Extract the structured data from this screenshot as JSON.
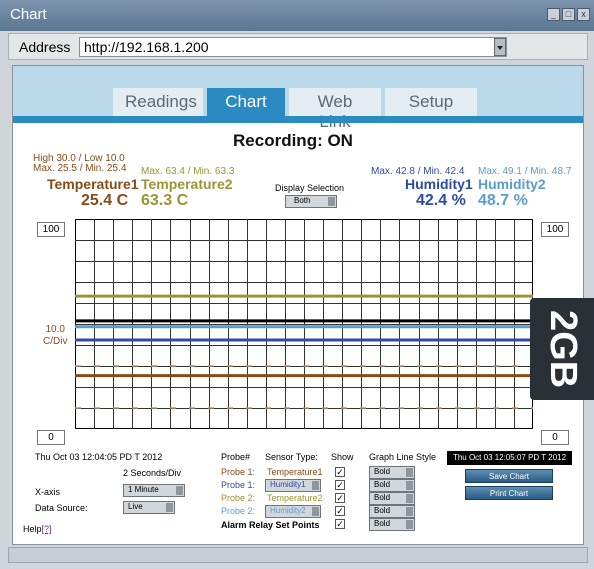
{
  "window": {
    "title": "Chart"
  },
  "address": {
    "label": "Address",
    "url": "http://192.168.1.200"
  },
  "tabs": [
    "Readings",
    "Chart",
    "Web Link",
    "Setup"
  ],
  "recording": "Recording: ON",
  "temp1": {
    "hilow": "High 30.0 / Low 10.0",
    "maxmin": "Max. 25.5 / Min. 25.4",
    "name": "Temperature1",
    "value": "25.4 C",
    "color": "#8a4b18"
  },
  "temp2": {
    "maxmin": "Max. 63.4 / Min. 63.3",
    "name": "Temperature2",
    "value": "63.3 C",
    "color": "#9a9433"
  },
  "hum1": {
    "maxmin": "Max. 42.8 / Min. 42.4",
    "name": "Humidity1",
    "value": "42.4 %",
    "color": "#2c4aa6"
  },
  "hum2": {
    "maxmin": "Max. 49.1 / Min. 48.7",
    "name": "Humidity2",
    "value": "48.7 %",
    "color": "#5b9bd0"
  },
  "display_selection": {
    "label": "Display Selection",
    "value": "Both"
  },
  "y_left_top": "100",
  "y_left_bottom": "0",
  "y_right_top": "100",
  "y_right_bottom": "0",
  "div_label": "10.0",
  "div_unit": "C/Div",
  "time_start": "Thu Oct 03 12:04:05 PD T 2012",
  "time_end": "Thu Oct 03 12:05:07 PD T 2012",
  "seconds_div": "2 Seconds/Div",
  "xaxis": {
    "label": "X-axis",
    "value": "1 Minute"
  },
  "datasource": {
    "label": "Data Source:",
    "value": "Live"
  },
  "probe_header": "Probe#",
  "sensor_header": "Sensor Type:",
  "show_header": "Show",
  "style_header": "Graph Line Style",
  "probes": [
    {
      "probe": "Probe 1:",
      "sensor": "Temperature1",
      "style": "Bold",
      "color": "#8a4b18"
    },
    {
      "probe": "Probe 1:",
      "sensor": "Humidity1",
      "style": "Bold",
      "color": "#2c4aa6"
    },
    {
      "probe": "Probe 2:",
      "sensor": "Temperature2",
      "style": "Bold",
      "color": "#9a9433"
    },
    {
      "probe": "Probe 2:",
      "sensor": "Humidity2",
      "style": "Bold",
      "color": "#5b9bd0"
    }
  ],
  "alarm_label": "Alarm Relay Set Points",
  "alarm_style": "Bold",
  "save_chart": "Save Chart",
  "print_chart": "Print Chart",
  "help": "Help",
  "help_link": "[?]",
  "gb_chip": "2GB",
  "chart_data": {
    "type": "line",
    "ylim": [
      0,
      100
    ],
    "series": [
      {
        "name": "Temperature1",
        "values": [
          25.4,
          25.4,
          25.4,
          25.4,
          25.4,
          25.4,
          25.4,
          25.4,
          25.4,
          25.4
        ],
        "color": "#8a4b18"
      },
      {
        "name": "Temperature2",
        "values": [
          63.3,
          63.3,
          63.3,
          63.3,
          63.3,
          63.3,
          63.3,
          63.3,
          63.3,
          63.3
        ],
        "color": "#9a9433"
      },
      {
        "name": "Humidity1",
        "values": [
          42.4,
          42.4,
          42.4,
          42.4,
          42.4,
          42.4,
          42.4,
          42.4,
          42.4,
          42.4
        ],
        "color": "#2c4aa6"
      },
      {
        "name": "Humidity2",
        "values": [
          48.7,
          48.7,
          48.7,
          48.7,
          48.7,
          48.7,
          48.7,
          48.7,
          48.7,
          48.7
        ],
        "color": "#5b9bd0"
      },
      {
        "name": "High",
        "values": [
          30,
          30,
          30,
          30,
          30,
          30,
          30,
          30,
          30,
          30
        ],
        "color": "#c88f6b"
      },
      {
        "name": "Low",
        "values": [
          10,
          10,
          10,
          10,
          10,
          10,
          10,
          10,
          10,
          10
        ],
        "color": "#c88f6b"
      },
      {
        "name": "Alarm",
        "values": [
          51.5,
          51.5,
          51.5,
          51.5,
          51.5,
          51.5,
          51.5,
          51.5,
          51.5,
          51.5
        ],
        "color": "#000000"
      }
    ],
    "grid": true
  }
}
